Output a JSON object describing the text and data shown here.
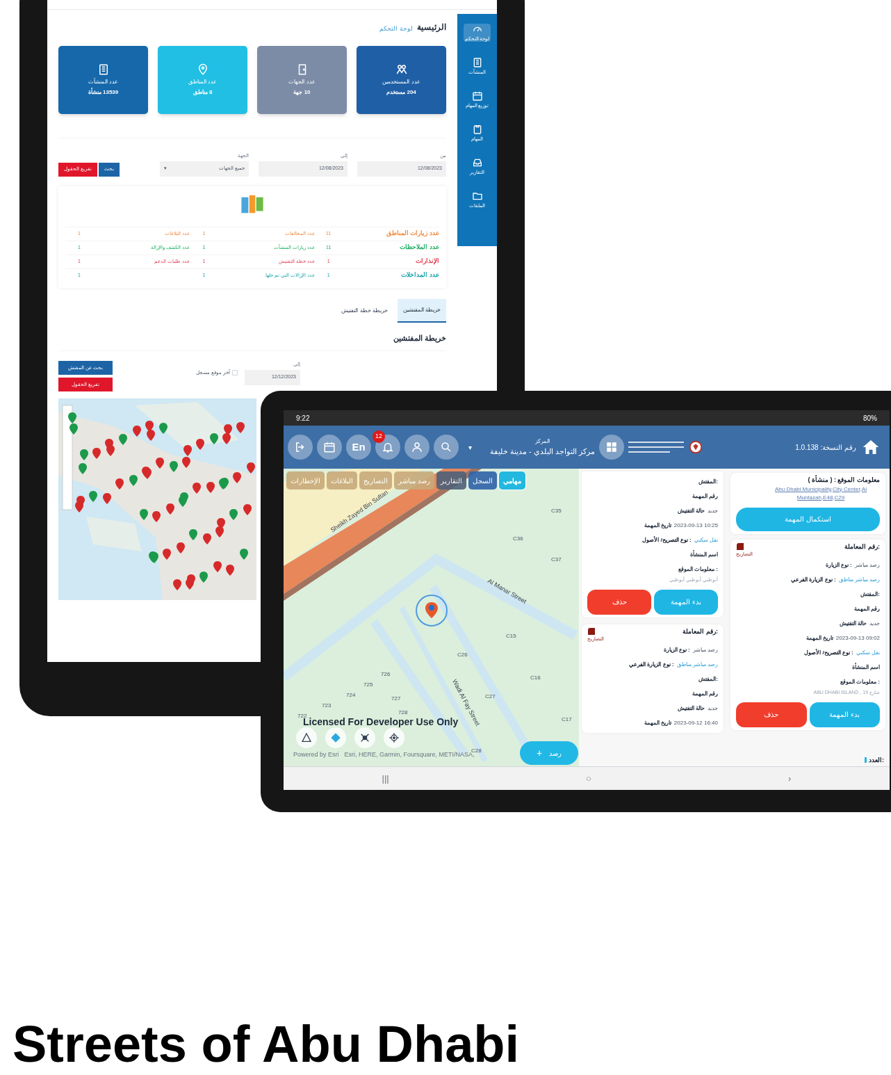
{
  "web_tablet": {
    "breadcrumb": {
      "current": "الرئيسية",
      "link": "لوحة التحكم"
    },
    "sidebar": [
      {
        "label": "لوحة التحكم",
        "selected": true
      },
      {
        "label": "المنشآت",
        "selected": false
      },
      {
        "label": "توزيع المهام",
        "selected": false
      },
      {
        "label": "المهام",
        "selected": false
      },
      {
        "label": "التقارير",
        "selected": false
      },
      {
        "label": "الملفات",
        "selected": false
      }
    ],
    "stat_cards": [
      {
        "label": "عدد المستخدمين",
        "value": "204 مستخدم",
        "color": "#1f5fa6"
      },
      {
        "label": "عدد الجهات",
        "value": "10 جهة",
        "color": "#7d8ca6"
      },
      {
        "label": "عدد المناطق",
        "value": "8 مناطق",
        "color": "#22bfe4"
      },
      {
        "label": "عدد المنشآت",
        "value": "13539 منشأة",
        "color": "#1668ab"
      }
    ],
    "filters": [
      {
        "label": "من",
        "value": "12/08/2023",
        "kind": "date"
      },
      {
        "label": "إلى",
        "value": "12/08/2023",
        "kind": "date"
      },
      {
        "label": "الجهة",
        "value": "جميع الجهات",
        "kind": "select",
        "caret": "▾"
      }
    ],
    "filter_buttons": [
      {
        "label": "بحث",
        "kind": "primary"
      },
      {
        "label": "تفريغ الحقول",
        "kind": "danger"
      }
    ],
    "stats_rows": [
      {
        "color": "#f0883c",
        "cells": [
          {
            "label": "عدد زيارات المناطق",
            "value": "11"
          },
          {
            "label": "عدد المخالفات",
            "value": "1"
          },
          {
            "label": "عدد البلاغات",
            "value": "1"
          }
        ]
      },
      {
        "color": "#1fae63",
        "cells": [
          {
            "label": "عدد الملاحظات",
            "value": "11"
          },
          {
            "label": "عدد زيارات المنشآت",
            "value": "1"
          },
          {
            "label": "عدد الكشف والإزالة",
            "value": "1"
          }
        ]
      },
      {
        "color": "#e23b4f",
        "cells": [
          {
            "label": "الإنذارات",
            "value": "1"
          },
          {
            "label": "عدد خطة التفتيش",
            "value": "1"
          },
          {
            "label": "عدد طلبات الدعم",
            "value": "1"
          }
        ]
      },
      {
        "color": "#16a3a8",
        "cells": [
          {
            "label": "عدد المداخلات",
            "value": "1"
          },
          {
            "label": "عدد الإزالات التي تم حلها",
            "value": "1"
          },
          {
            "value": "1"
          }
        ]
      }
    ],
    "map_tabs": [
      {
        "label": "خريطة المفتشين",
        "selected": true
      },
      {
        "label": "خريطة خطة التفتيش",
        "selected": false
      }
    ],
    "section_title": "خريطة المفتشين",
    "map_filter": {
      "label": "إلى",
      "value": "12/12/2023",
      "checkbox": {
        "label": "آخر موقع مسجل",
        "checked": false
      }
    },
    "map_buttons": [
      {
        "label": "بحث عن المفتش",
        "kind": "primary"
      },
      {
        "label": "تفريغ الحقول",
        "kind": "danger"
      }
    ]
  },
  "mobile_tablet": {
    "status_bar": {
      "time": "9:22",
      "battery": "80%"
    },
    "header": {
      "menu_caret": "▾",
      "version": "رقم النسخة: 1.0.138",
      "center_caption": "المركز",
      "center": "مركز التواجد البلدي - مدينة خليفة",
      "language": "En",
      "notifications": "12"
    },
    "tabs": [
      {
        "label": "مهامي",
        "selected": true,
        "color": "#22b8e0"
      },
      {
        "label": "السجل",
        "selected": false,
        "color": "#2f63a8"
      },
      {
        "label": "التقارير",
        "selected": false,
        "color": "#4f6178"
      },
      {
        "label": "رصد مباشر",
        "selected": false,
        "color": "#c8aa7a"
      },
      {
        "label": "التصاريح",
        "selected": false,
        "color": "#c8aa7a"
      },
      {
        "label": "البلاغات",
        "selected": false,
        "color": "#c8aa7a"
      },
      {
        "label": "الإخطارات",
        "selected": false,
        "color": "#c8aa7a"
      }
    ],
    "map": {
      "streets": [
        "Sheikh Zayed Bin Sultan",
        "Al Manar Street",
        "Wadi Al Fay Street"
      ],
      "parcels": [
        "C35",
        "C36",
        "C37",
        "C15",
        "C16",
        "C17",
        "C26",
        "C27",
        "C28",
        "722",
        "723",
        "724",
        "725",
        "726",
        "727",
        "728"
      ],
      "watermark": "Licensed For Developer Use Only",
      "attribution": "Powered by Esri",
      "sources": "Esri, HERE, Garmin, Foursquare, METI/NASA,",
      "add_button": {
        "icon": "+",
        "label": "رصد"
      }
    },
    "task_column_left": [
      {
        "kind": "task_tail",
        "fields": [
          {
            "label": "المفتش:",
            "kind": "plain"
          },
          {
            "label": "رقم المهمة",
            "kind": "plain"
          },
          {
            "label": "حالة التفتيش",
            "value": "جديد",
            "kind": "plain"
          },
          {
            "label": "تاريخ المهمة",
            "value": "2023-09-13 10:25",
            "kind": "plain"
          },
          {
            "label": "نوع التصريح/ الأصول :",
            "value": "نقل سكني",
            "kind": "link"
          },
          {
            "label": "اسم المنشأة",
            "kind": "plain"
          },
          {
            "label": "معلومات الموقع :",
            "kind": "plain"
          }
        ],
        "location": "أبوظبي أبوظبي أبوظبي",
        "buttons": [
          {
            "label": "بدء المهمة",
            "kind": "start"
          },
          {
            "label": "حذف",
            "kind": "delete"
          }
        ]
      },
      {
        "kind": "task",
        "title": "رقم المعاملة:",
        "tag": "التصاريح",
        "fields": [
          {
            "label": "نوع الزيارة :",
            "value": "رصد مباشر",
            "kind": "plain"
          },
          {
            "label": "نوع الزيارة الفرعي :",
            "value": "رصد مباشر مناطق",
            "kind": "link"
          },
          {
            "label": "المفتش:",
            "kind": "plain"
          },
          {
            "label": "رقم المهمة",
            "kind": "plain"
          },
          {
            "label": "حالة التفتيش",
            "value": "جديد",
            "kind": "plain"
          },
          {
            "label": "تاريخ المهمة",
            "value": "2023-09-12 16:40",
            "kind": "plain"
          }
        ]
      }
    ],
    "task_column_right": [
      {
        "kind": "site",
        "title": "معلومات الموقع : ( منشأة )",
        "link": "Abu Dhabi Municipality,City Center,Al Muntazah,E48,C29",
        "buttons": [
          {
            "label": "استكمال المهمة",
            "kind": "start"
          }
        ]
      },
      {
        "kind": "task",
        "title": "رقم المعاملة:",
        "tag": "التصاريح",
        "fields": [
          {
            "label": "نوع الزيارة :",
            "value": "رصد مباشر",
            "kind": "plain"
          },
          {
            "label": "نوع الزيارة الفرعي :",
            "value": "رصد مباشر مناطق",
            "kind": "link"
          },
          {
            "label": "المفتش:",
            "kind": "plain"
          },
          {
            "label": "رقم المهمة",
            "kind": "plain"
          },
          {
            "label": "حالة التفتيش",
            "value": "جديد",
            "kind": "plain"
          },
          {
            "label": "تاريخ المهمة",
            "value": "2023-09-13 09:02",
            "kind": "plain"
          },
          {
            "label": "نوع التصريح/ الأصول :",
            "value": "نقل سكني",
            "kind": "link"
          },
          {
            "label": "اسم المنشأة",
            "kind": "plain"
          },
          {
            "label": "معلومات الموقع :",
            "kind": "plain"
          }
        ],
        "location": "ABU DHABI ISLAND , 19 شارع",
        "buttons": [
          {
            "label": "بدء المهمة",
            "kind": "start"
          },
          {
            "label": "حذف",
            "kind": "delete"
          }
        ]
      }
    ],
    "count_label": "العدد:",
    "nav_buttons": [
      "‹",
      "○",
      "|||"
    ]
  },
  "headline": "Streets of Abu Dhabi"
}
